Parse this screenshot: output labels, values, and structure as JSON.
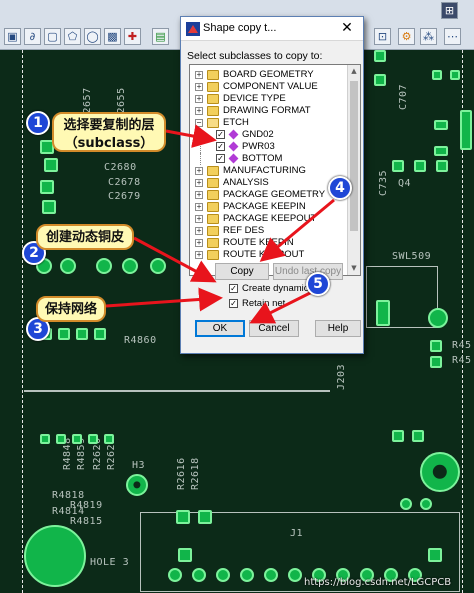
{
  "dialog": {
    "title": "Shape copy t...",
    "close_glyph": "✕",
    "prompt": "Select subclasses to copy to:",
    "tree": [
      {
        "label": "BOARD GEOMETRY",
        "expanded": false
      },
      {
        "label": "COMPONENT VALUE",
        "expanded": false
      },
      {
        "label": "DEVICE TYPE",
        "expanded": false
      },
      {
        "label": "DRAWING FORMAT",
        "expanded": false
      },
      {
        "label": "ETCH",
        "expanded": true
      },
      {
        "label": "GND02",
        "child": true,
        "checked": true
      },
      {
        "label": "PWR03",
        "child": true,
        "checked": true
      },
      {
        "label": "BOTTOM",
        "child": true,
        "checked": true
      },
      {
        "label": "MANUFACTURING",
        "expanded": false
      },
      {
        "label": "ANALYSIS",
        "expanded": false
      },
      {
        "label": "PACKAGE GEOMETRY",
        "expanded": false
      },
      {
        "label": "PACKAGE KEEPIN",
        "expanded": false
      },
      {
        "label": "PACKAGE KEEPOUT",
        "expanded": false
      },
      {
        "label": "REF DES",
        "expanded": false
      },
      {
        "label": "ROUTE KEEPIN",
        "expanded": false
      },
      {
        "label": "ROUTE KEEPOUT",
        "expanded": false
      }
    ],
    "copy_label": "Copy",
    "undo_label": "Undo last copy",
    "create_dynamic_label": "Create dynamic sh",
    "create_dynamic_checked": true,
    "retain_net_label": "Retain net",
    "retain_net_checked": true,
    "ok_label": "OK",
    "cancel_label": "Cancel",
    "help_label": "Help"
  },
  "annotations": {
    "a1": {
      "num": "1",
      "line1": "选择要复制的层",
      "line2": "（subclass）"
    },
    "a2": {
      "num": "2",
      "text": "创建动态铜皮"
    },
    "a3": {
      "num": "3",
      "text": "保持网络"
    },
    "a4": {
      "num": "4"
    },
    "a5": {
      "num": "5"
    },
    "arrow_color": "#e8141c"
  },
  "pcb": {
    "labels": {
      "r2657": "R2657",
      "r2655": "R2655",
      "c2680": "C2680",
      "c2678": "C2678",
      "c2679": "C2679",
      "r4860": "R4860",
      "r4861": "R4861",
      "r4848": "R4848",
      "r4859": "R4859",
      "r2620": "R2620",
      "r2622": "R2622",
      "r4818": "R4818",
      "r4819": "R4819",
      "r4814": "R4814",
      "r4815": "R4815",
      "r2616": "R2616",
      "r2618": "R2618",
      "h3": "H3",
      "hole3": "HOLE 3",
      "j1": "J1",
      "j203": "J203",
      "c735": "C735",
      "q4": "Q4",
      "swl509": "SWL509",
      "r45a": "R45",
      "r45b": "R45",
      "c707": "C707"
    }
  },
  "watermark": "https://blog.csdn.net/LGCPCB"
}
